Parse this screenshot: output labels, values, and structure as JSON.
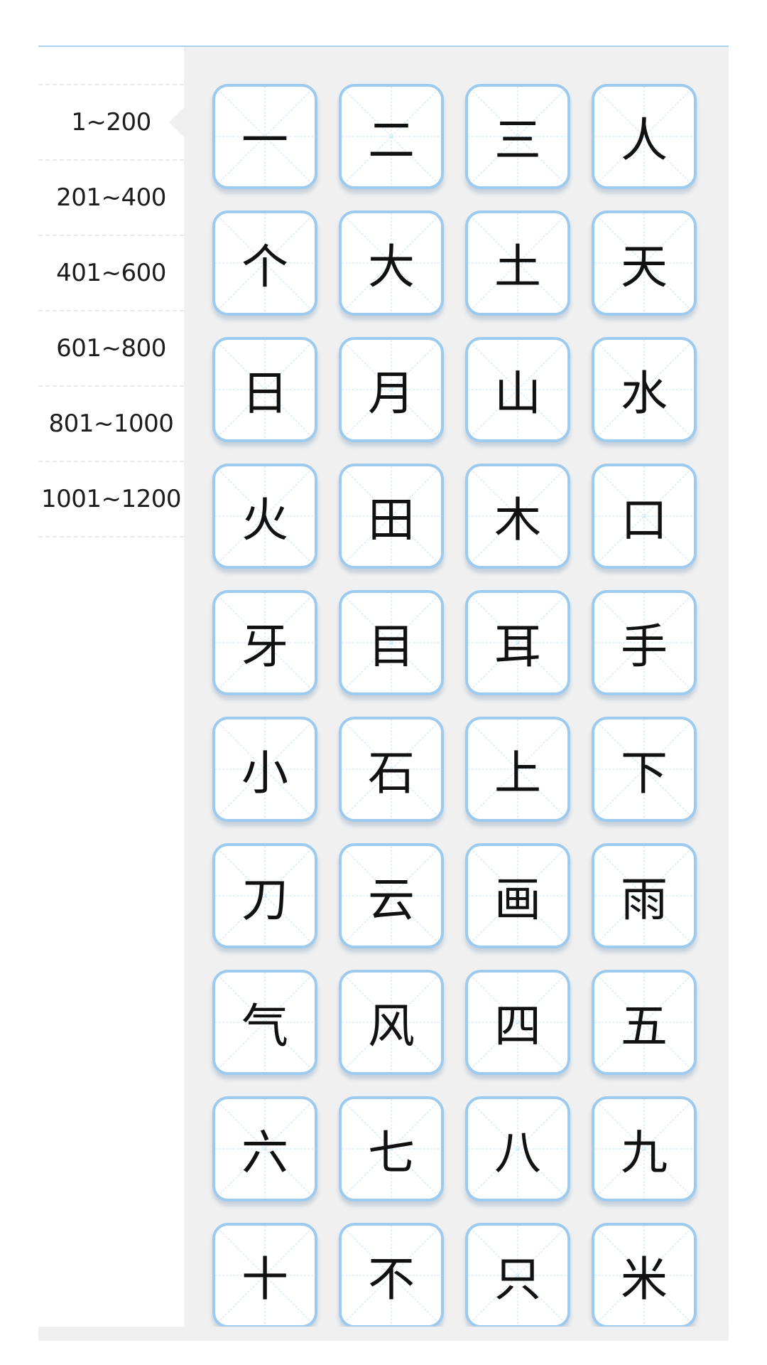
{
  "colors": {
    "accent_line": "#a9d2ee",
    "card_border": "#9ccbef",
    "guide_line": "#b7dcf5",
    "panel_background": "#f0f0f0"
  },
  "sidebar": {
    "active_index": 0,
    "ranges": [
      {
        "label": "1~200"
      },
      {
        "label": "201~400"
      },
      {
        "label": "401~600"
      },
      {
        "label": "601~800"
      },
      {
        "label": "801~1000"
      },
      {
        "label": "1001~1200"
      }
    ]
  },
  "characters": [
    "一",
    "二",
    "三",
    "人",
    "个",
    "大",
    "土",
    "天",
    "日",
    "月",
    "山",
    "水",
    "火",
    "田",
    "木",
    "口",
    "牙",
    "目",
    "耳",
    "手",
    "小",
    "石",
    "上",
    "下",
    "刀",
    "云",
    "画",
    "雨",
    "气",
    "风",
    "四",
    "五",
    "六",
    "七",
    "八",
    "九",
    "十",
    "不",
    "只",
    "米"
  ]
}
